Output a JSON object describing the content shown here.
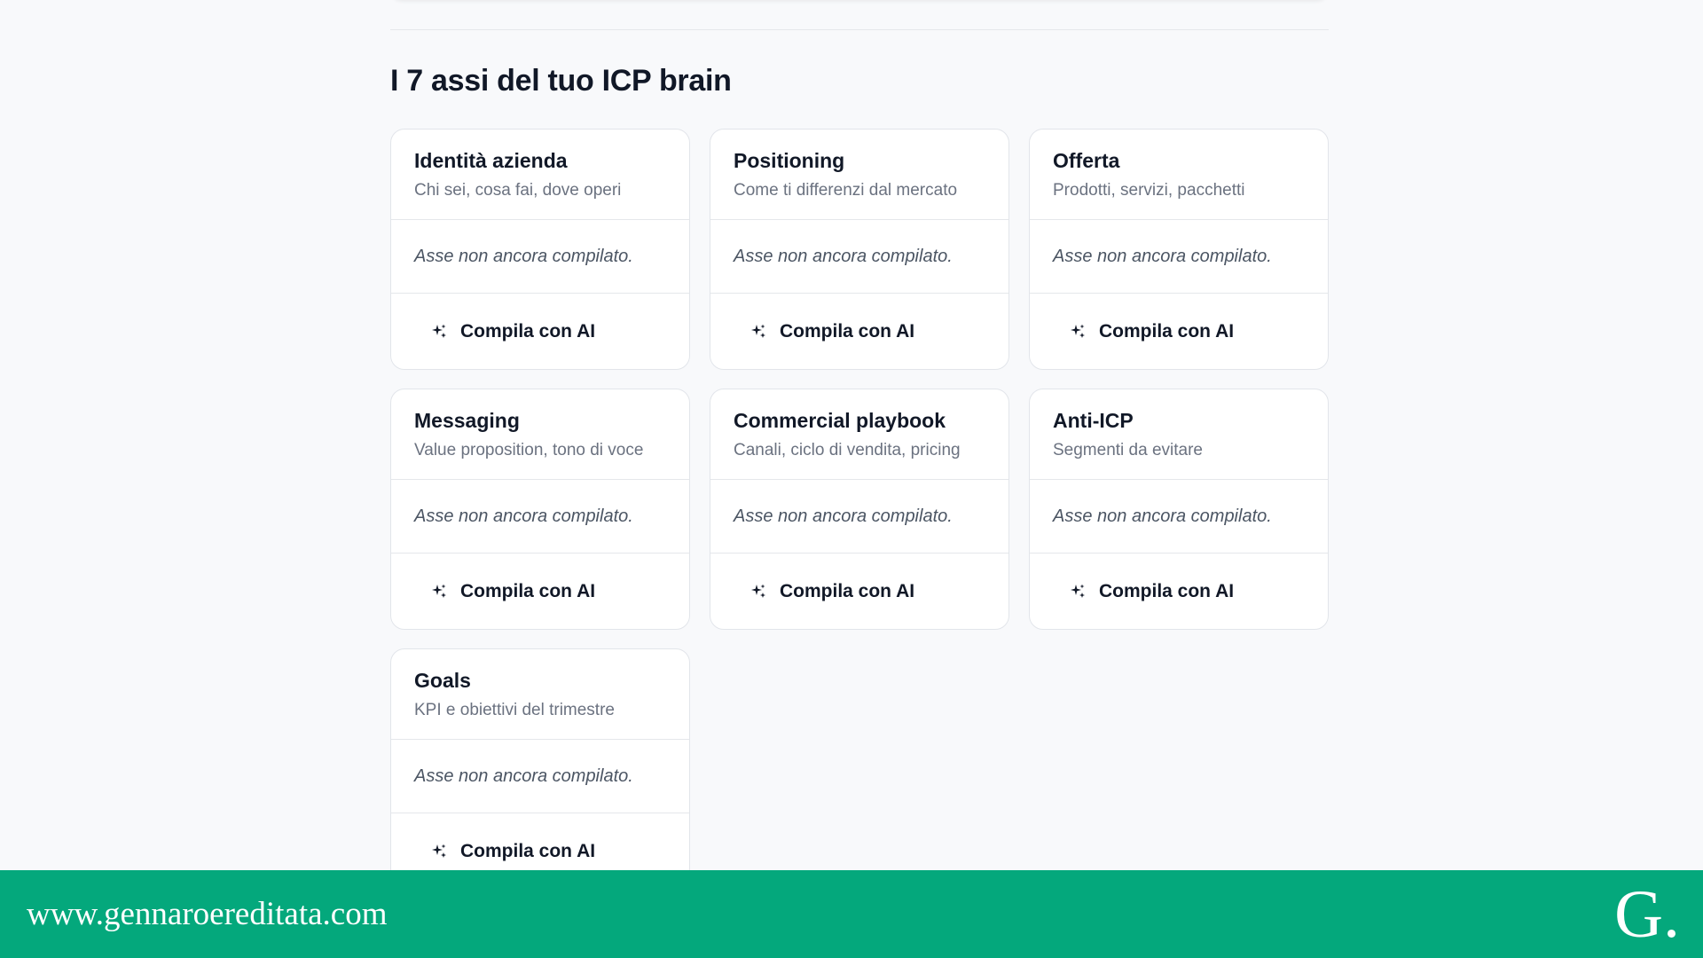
{
  "section": {
    "title": "I 7 assi del tuo ICP brain"
  },
  "cards": [
    {
      "title": "Identità azienda",
      "subtitle": "Chi sei, cosa fai, dove operi",
      "status": "Asse non ancora compilato.",
      "action": "Compila con AI"
    },
    {
      "title": "Positioning",
      "subtitle": "Come ti differenzi dal mercato",
      "status": "Asse non ancora compilato.",
      "action": "Compila con AI"
    },
    {
      "title": "Offerta",
      "subtitle": "Prodotti, servizi, pacchetti",
      "status": "Asse non ancora compilato.",
      "action": "Compila con AI"
    },
    {
      "title": "Messaging",
      "subtitle": "Value proposition, tono di voce",
      "status": "Asse non ancora compilato.",
      "action": "Compila con AI"
    },
    {
      "title": "Commercial playbook",
      "subtitle": "Canali, ciclo di vendita, pricing",
      "status": "Asse non ancora compilato.",
      "action": "Compila con AI"
    },
    {
      "title": "Anti-ICP",
      "subtitle": "Segmenti da evitare",
      "status": "Asse non ancora compilato.",
      "action": "Compila con AI"
    },
    {
      "title": "Goals",
      "subtitle": "KPI e obiettivi del trimestre",
      "status": "Asse non ancora compilato.",
      "action": "Compila con AI"
    }
  ],
  "icons": {
    "action_icon": "sparkle-icon"
  },
  "footer": {
    "url": "www.gennaroereditata.com",
    "logo": "G."
  },
  "colors": {
    "background": "#f8f9fb",
    "card_border": "#e2e5ea",
    "footer_bg": "#04a87c"
  }
}
